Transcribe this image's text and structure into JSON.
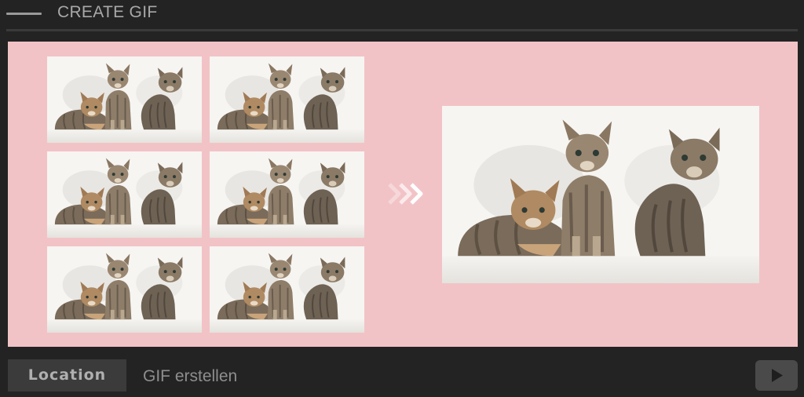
{
  "header": {
    "title": "CREATE GIF",
    "menu_icon": "dash-icon"
  },
  "preview": {
    "frame_count": 6,
    "frame_subject": "three kittens photo",
    "arrow_icon": "triple-chevron-right-icon",
    "background_color": "#f2c3c6"
  },
  "footer": {
    "location_label": "Location",
    "path_label": "GIF erstellen",
    "play_icon": "play-icon"
  }
}
